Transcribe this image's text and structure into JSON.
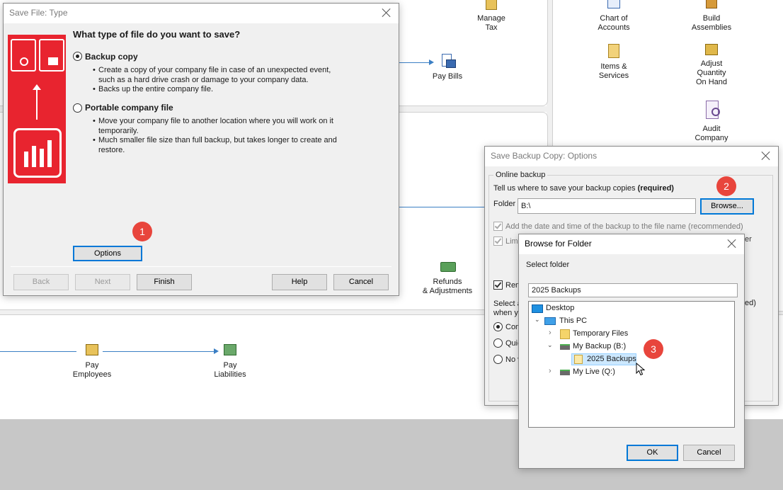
{
  "home": {
    "labels": {
      "manage_tax": "Manage\nTax",
      "pay_bills": "Pay Bills",
      "chart_of_accounts": "Chart of\nAccounts",
      "build_assemblies": "Build\nAssemblies",
      "items_services": "Items &\nServices",
      "adjust_qty": "Adjust\nQuantity\nOn Hand",
      "audit_company": "Audit\nCompany",
      "refunds": "Refunds\n& Adjustments",
      "pay_employees": "Pay\nEmployees",
      "pay_liabilities": "Pay\nLiabilities"
    }
  },
  "save_type": {
    "title": "Save File: Type",
    "heading": "What type of file do you want to save?",
    "backup_label": "Backup copy",
    "backup_b1": "Create a copy of your company file in case of an unexpected event,",
    "backup_b1b": "such as a hard drive crash or damage to your company data.",
    "backup_b2": "Backs up the entire company file.",
    "portable_label": "Portable company file",
    "portable_b1": "Move your company file to another location where you will work on it",
    "portable_b1b": "temporarily.",
    "portable_b2": "Much smaller file size than full backup, but takes longer to create and",
    "portable_b2b": "restore.",
    "options": "Options",
    "back": "Back",
    "next": "Next",
    "finish": "Finish",
    "help": "Help",
    "cancel": "Cancel"
  },
  "backup_options": {
    "title": "Save Backup Copy: Options",
    "group_label": "Online backup",
    "where_text": "Tell us where to save your backup copies",
    "required": "(required)",
    "folder_label": "Folder",
    "folder_value": "B:\\",
    "browse": "Browse...",
    "add_date": "Add the date and time of the backup to the file name (recommended)",
    "limit": "Limi",
    "limit_right": "er",
    "remind": "Rem",
    "select_a": "Select a",
    "when_y": "when y",
    "ed_tail": "ed)",
    "opt_com": "Com",
    "opt_quic": "Quic",
    "opt_no": "No v"
  },
  "browse_folder": {
    "title": "Browse for Folder",
    "select_label": "Select folder",
    "path_value": "2025 Backups",
    "tree": {
      "desktop": "Desktop",
      "this_pc": "This PC",
      "temp_files": "Temporary Files",
      "my_backup": "My Backup (B:)",
      "backups_2025": "2025 Backups",
      "my_live": "My Live (Q:)"
    },
    "ok": "OK",
    "cancel": "Cancel"
  },
  "badges": {
    "one": "1",
    "two": "2",
    "three": "3"
  },
  "colors": {
    "accent": "#0078d7",
    "badge": "#e8453c",
    "brand_red": "#e8242f",
    "flow": "#3b7fc4"
  }
}
